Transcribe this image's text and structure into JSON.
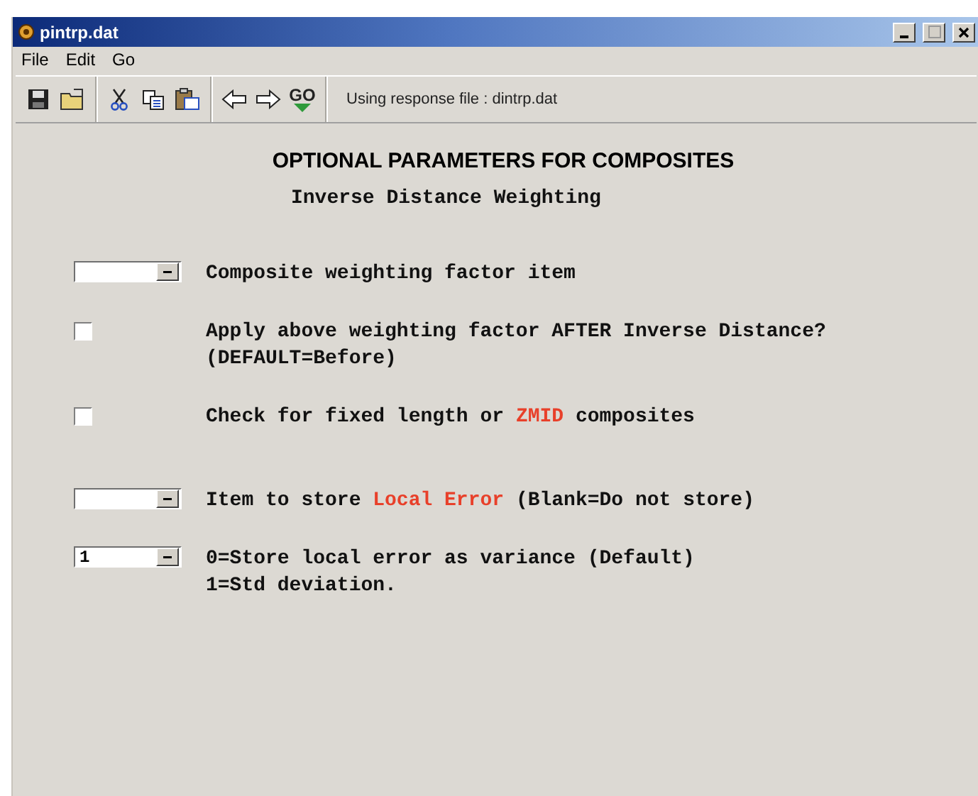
{
  "window": {
    "title": "pintrp.dat"
  },
  "menu": [
    "File",
    "Edit",
    "Go"
  ],
  "toolbar": {
    "groups": [
      [
        {
          "kind": "save"
        },
        {
          "kind": "open"
        }
      ],
      [
        {
          "kind": "cut"
        },
        {
          "kind": "copy"
        },
        {
          "kind": "paste"
        }
      ],
      [
        {
          "kind": "back"
        },
        {
          "kind": "forward"
        },
        {
          "kind": "go",
          "label": "GO"
        }
      ]
    ],
    "status": "Using response file : dintrp.dat"
  },
  "heading": "OPTIONAL PARAMETERS FOR COMPOSITES",
  "subheading": "Inverse Distance Weighting",
  "rows": [
    {
      "kind": "dropdown",
      "lines": [
        [
          {
            "text": "Composite weighting factor item",
            "highlighted": false
          }
        ]
      ]
    },
    {
      "kind": "checkbox",
      "checked": false,
      "lines": [
        [
          {
            "text": "Apply above weighting factor AFTER Inverse Distance?",
            "highlighted": false
          }
        ],
        [
          {
            "text": "(DEFAULT=Before)",
            "highlighted": false
          }
        ]
      ]
    },
    {
      "kind": "checkbox",
      "checked": false,
      "lines": [
        [
          {
            "text": "Check for fixed length or ",
            "highlighted": false
          },
          {
            "text": "ZMID",
            "highlighted": true
          },
          {
            "text": " composites",
            "highlighted": false
          }
        ]
      ]
    },
    {
      "kind": "dropdown",
      "lines": [
        [
          {
            "text": "Item to store ",
            "highlighted": false
          },
          {
            "text": "Local Error",
            "highlighted": true
          },
          {
            "text": " (Blank=Do not store)",
            "highlighted": false
          }
        ]
      ]
    },
    {
      "kind": "dropdown",
      "value": "1",
      "lines": [
        [
          {
            "text": "0=Store local error as variance (Default)",
            "highlighted": false
          }
        ],
        [
          {
            "text": "1=Std deviation.",
            "highlighted": false
          }
        ]
      ]
    }
  ]
}
